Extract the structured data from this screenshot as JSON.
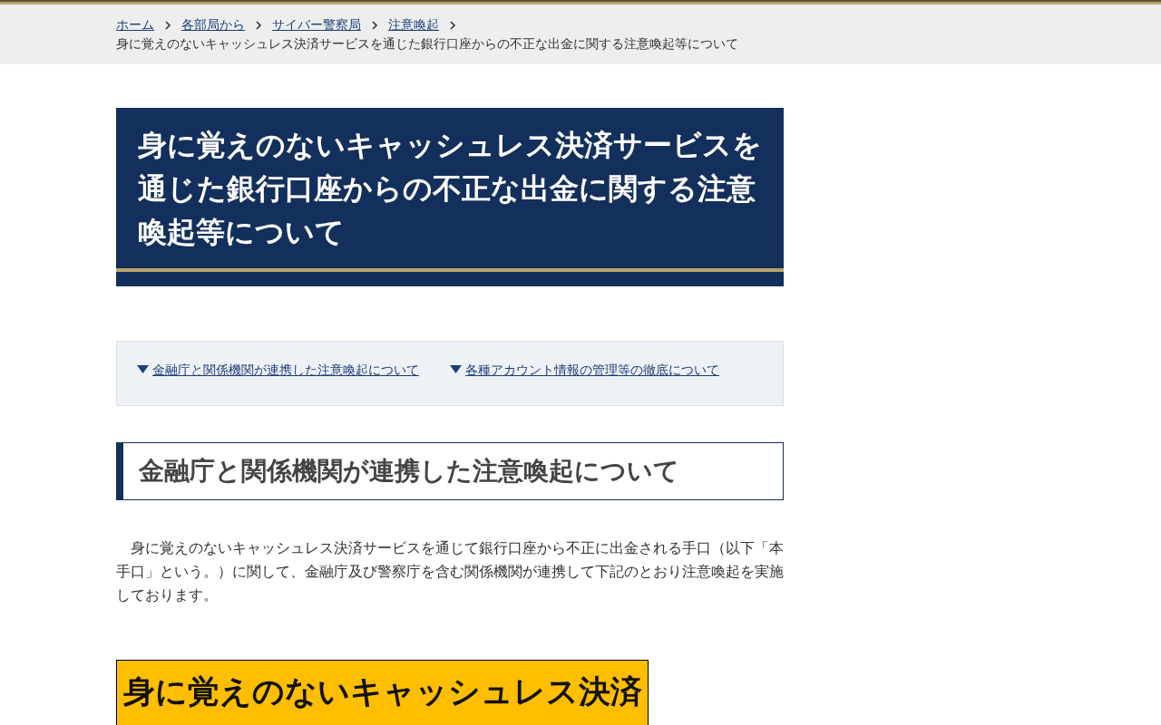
{
  "breadcrumb": {
    "links": [
      "ホーム",
      "各部局から",
      "サイバー警察局",
      "注意喚起"
    ],
    "current": "身に覚えのないキャッシュレス決済サービスを通じた銀行口座からの不正な出金に関する注意喚起等について"
  },
  "title": "身に覚えのないキャッシュレス決済サービスを通じた銀行口座からの不正な出金に関する注意喚起等について",
  "toc": [
    "金融庁と関係機関が連携した注意喚起について",
    "各種アカウント情報の管理等の徹底について"
  ],
  "section": {
    "heading": "金融庁と関係機関が連携した注意喚起について",
    "paragraph": "　身に覚えのないキャッシュレス決済サービスを通じて銀行口座から不正に出金される手口（以下「本手口」という。）に関して、金融庁及び警察庁を含む関係機関が連携して下記のとおり注意喚起を実施しております。",
    "banner": "身に覚えのないキャッシュレス決済"
  }
}
